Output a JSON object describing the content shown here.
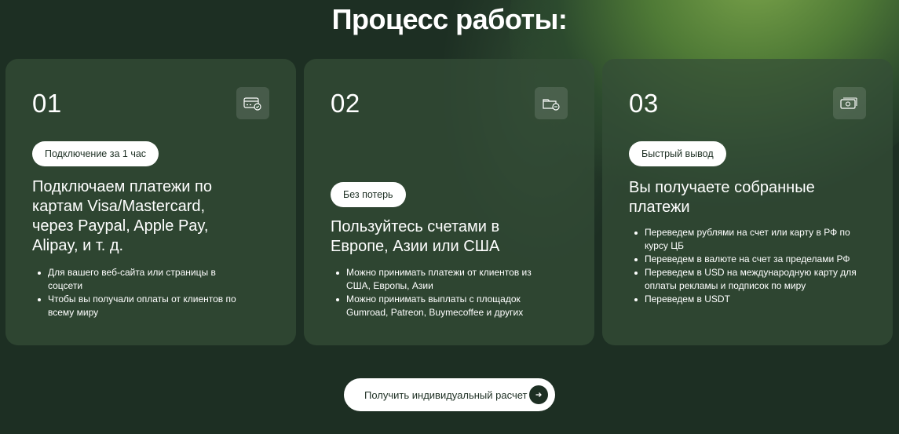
{
  "heading": "Процесс работы:",
  "cards": [
    {
      "number": "01",
      "icon": "card-icon",
      "tag": "Подключение за 1 час",
      "title": "Подключаем платежи по картам Visa/Mastercard, через Paypal, Apple Pay, Alipay, и т. д.",
      "bullets": [
        "Для вашего веб-сайта или страницы в соцсети",
        "Чтобы вы получали оплаты от клиентов по всему миру"
      ]
    },
    {
      "number": "02",
      "icon": "wallet-icon",
      "tag": "Без потерь",
      "title": "Пользуйтесь счетами в Европе, Азии или США",
      "bullets": [
        "Можно принимать платежи от клиентов из США, Европы, Азии",
        "Можно принимать выплаты с площадок Gumroad, Patreon, Buymecoffee и других"
      ]
    },
    {
      "number": "03",
      "icon": "money-icon",
      "tag": "Быстрый вывод",
      "title": "Вы получаете собранные платежи",
      "bullets": [
        "Переведем рублями на счет или карту в РФ по курсу ЦБ",
        "Переведем в валюте на счет за пределами РФ",
        "Переведем в USD на международную карту для оплаты рекламы и подписок по миру",
        "Переведем в USDT"
      ]
    }
  ],
  "cta": {
    "label": "Получить индивидуальный расчет",
    "icon": "arrow-right-icon"
  },
  "colors": {
    "background": "#1d2f23",
    "card": "#344e38",
    "accent": "#7aa34a"
  }
}
